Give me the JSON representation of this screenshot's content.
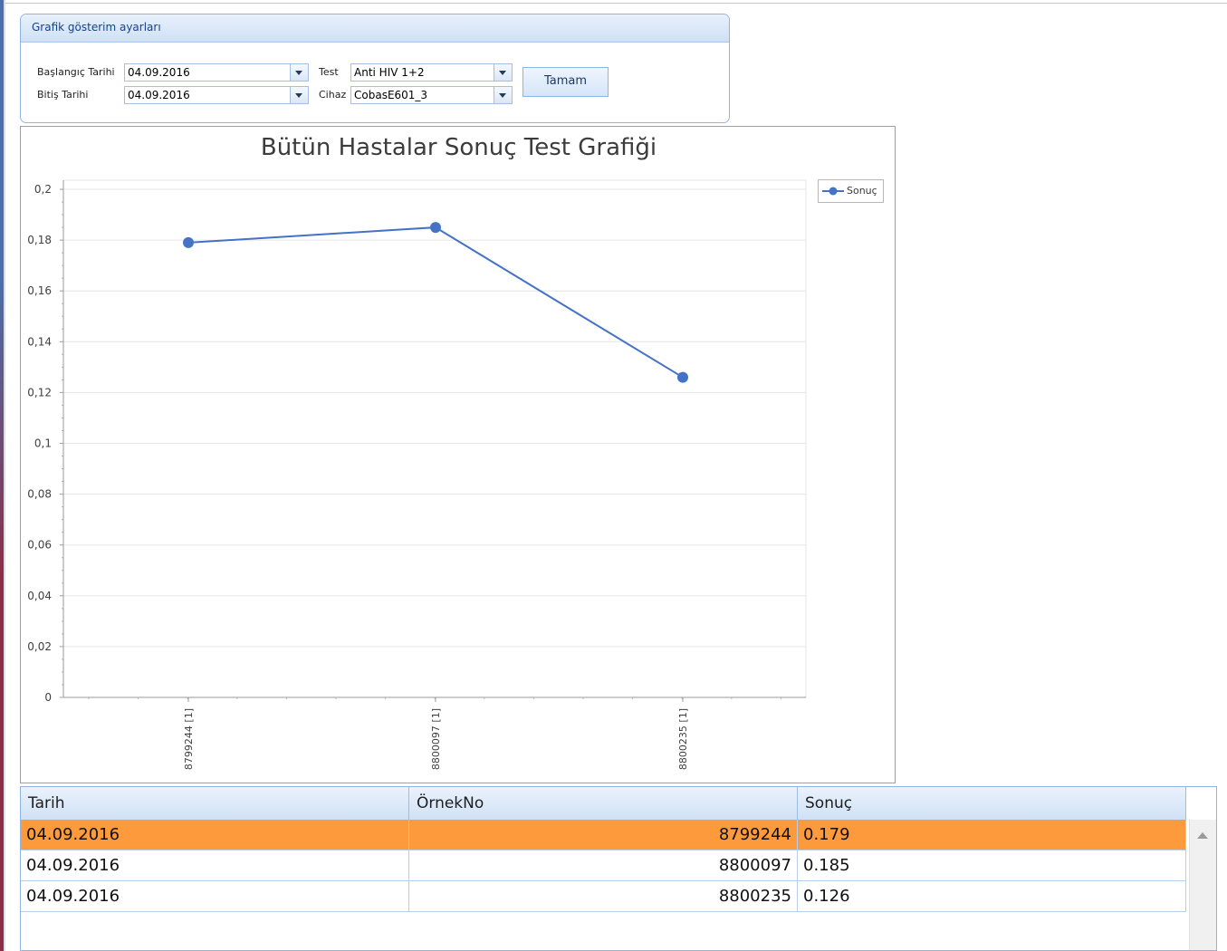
{
  "settings": {
    "title": "Grafik gösterim ayarları",
    "start_label": "Başlangıç Tarihi",
    "start_value": "04.09.2016",
    "end_label": "Bitiş Tarihi",
    "end_value": "04.09.2016",
    "test_label": "Test",
    "test_value": "Anti HIV 1+2",
    "device_label": "Cihaz",
    "device_value": "CobasE601_3",
    "ok_label": "Tamam"
  },
  "chart_data": {
    "type": "line",
    "title": "Bütün Hastalar Sonuç Test Grafiği",
    "categories": [
      "8799244 [1]",
      "8800097 [1]",
      "8800235 [1]"
    ],
    "series": [
      {
        "name": "Sonuç",
        "values": [
          0.179,
          0.185,
          0.126
        ],
        "color": "#4472c4"
      }
    ],
    "ylim": [
      0,
      0.2
    ],
    "yticks": [
      "0",
      "0,02",
      "0,04",
      "0,06",
      "0,08",
      "0,1",
      "0,12",
      "0,14",
      "0,16",
      "0,18",
      "0,2"
    ],
    "grid": true,
    "legend_position": "top-right"
  },
  "grid": {
    "columns": [
      "Tarih",
      "ÖrnekNo",
      "Sonuç"
    ],
    "rows": [
      {
        "date": "04.09.2016",
        "sample": "8799244",
        "result": "0.179",
        "selected": true
      },
      {
        "date": "04.09.2016",
        "sample": "8800097",
        "result": "0.185",
        "selected": false
      },
      {
        "date": "04.09.2016",
        "sample": "8800235",
        "result": "0.126",
        "selected": false
      }
    ],
    "selected_color": "#fd9a3c"
  }
}
